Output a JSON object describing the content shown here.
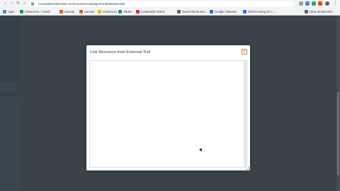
{
  "browser": {
    "url": "mcsaddressdecivile.com/courses/1/assignments/55484xx69",
    "bookmarks": [
      {
        "label": "Apps",
        "color": "#4285f4"
      },
      {
        "label": "Classroom – Activit",
        "color": "#0f9d58"
      },
      {
        "label": "Canvas",
        "color": "#e66000"
      },
      {
        "label": "Canvas",
        "color": "#e66000"
      },
      {
        "label": "Classroom",
        "color": "#f4b400"
      },
      {
        "label": "Tables",
        "color": "#0f9d58"
      },
      {
        "label": "Leadership Online",
        "color": "#d93025"
      },
      {
        "label": "Teach Plants Kee…",
        "color": "#5f6368"
      },
      {
        "label": "Google AdSense",
        "color": "#1a73e8"
      },
      {
        "label": "What's Going On I…",
        "color": "#1a73e8"
      },
      {
        "label": "Other Bookmarks",
        "color": "#5f6368"
      }
    ]
  },
  "modal": {
    "title": "Link Resource from External Tool",
    "close_label": "×"
  },
  "colors": {
    "page_bg": "#3b4349",
    "close_border": "#c98a3b"
  }
}
